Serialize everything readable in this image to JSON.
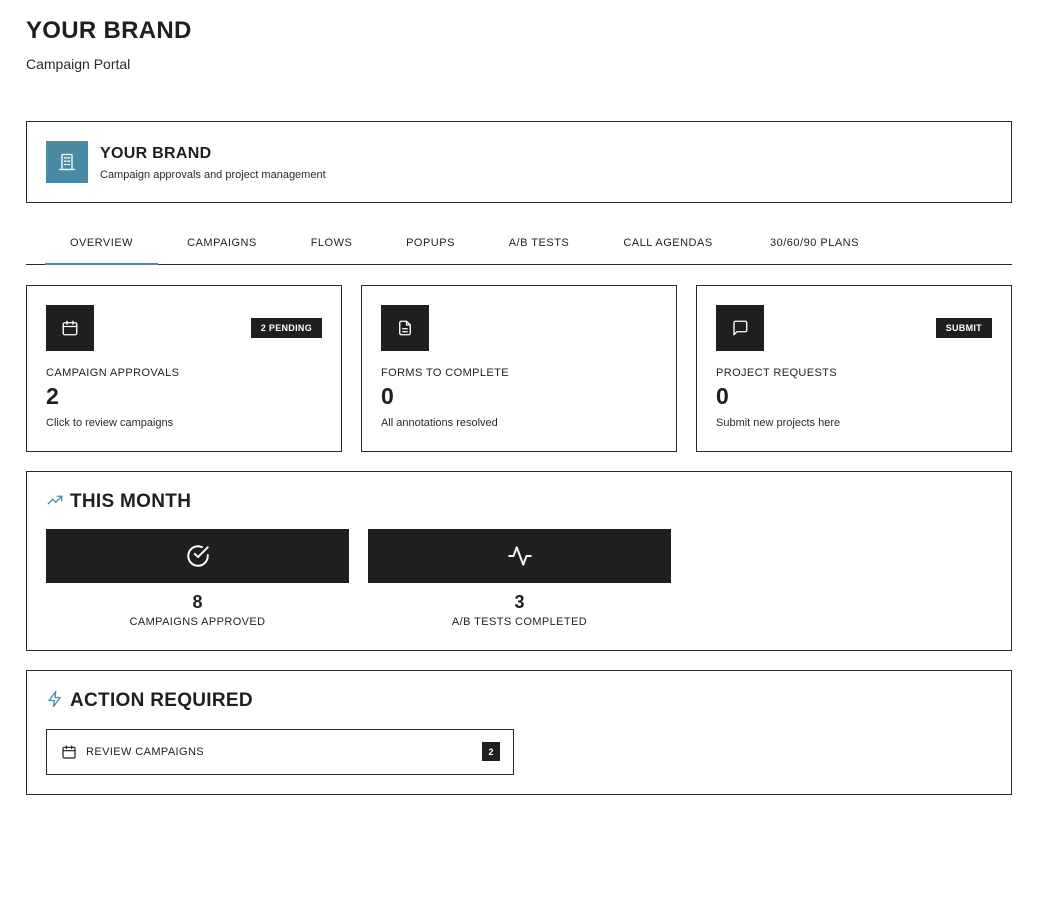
{
  "header": {
    "brand_title": "YOUR BRAND",
    "brand_subtitle": "Campaign Portal"
  },
  "brand_card": {
    "title": "YOUR BRAND",
    "subtitle": "Campaign approvals and project management",
    "logo_icon": "building-icon",
    "logo_color": "#4a8ba3"
  },
  "tabs": [
    {
      "label": "OVERVIEW",
      "active": true
    },
    {
      "label": "CAMPAIGNS",
      "active": false
    },
    {
      "label": "FLOWS",
      "active": false
    },
    {
      "label": "POPUPS",
      "active": false
    },
    {
      "label": "A/B TESTS",
      "active": false
    },
    {
      "label": "CALL AGENDAS",
      "active": false
    },
    {
      "label": "30/60/90 PLANS",
      "active": false
    }
  ],
  "stat_cards": [
    {
      "icon": "calendar-icon",
      "badge": "2 PENDING",
      "label": "CAMPAIGN APPROVALS",
      "value": "2",
      "sub": "Click to review campaigns"
    },
    {
      "icon": "document-icon",
      "badge": "",
      "label": "FORMS TO COMPLETE",
      "value": "0",
      "sub": "All annotations resolved"
    },
    {
      "icon": "chat-icon",
      "badge": "SUBMIT",
      "label": "PROJECT REQUESTS",
      "value": "0",
      "sub": "Submit new projects here"
    }
  ],
  "this_month": {
    "title": "THIS MONTH",
    "icon": "trending-up-icon",
    "metrics": [
      {
        "icon": "check-circle-icon",
        "value": "8",
        "label": "CAMPAIGNS APPROVED"
      },
      {
        "icon": "activity-icon",
        "value": "3",
        "label": "A/B TESTS COMPLETED"
      }
    ]
  },
  "action_required": {
    "title": "ACTION REQUIRED",
    "icon": "lightning-icon",
    "items": [
      {
        "icon": "calendar-icon",
        "label": "REVIEW CAMPAIGNS",
        "count": "2"
      }
    ]
  },
  "colors": {
    "accent": "#4a8ba3",
    "dark": "#1f1f1f",
    "border": "#2b2b2b"
  }
}
